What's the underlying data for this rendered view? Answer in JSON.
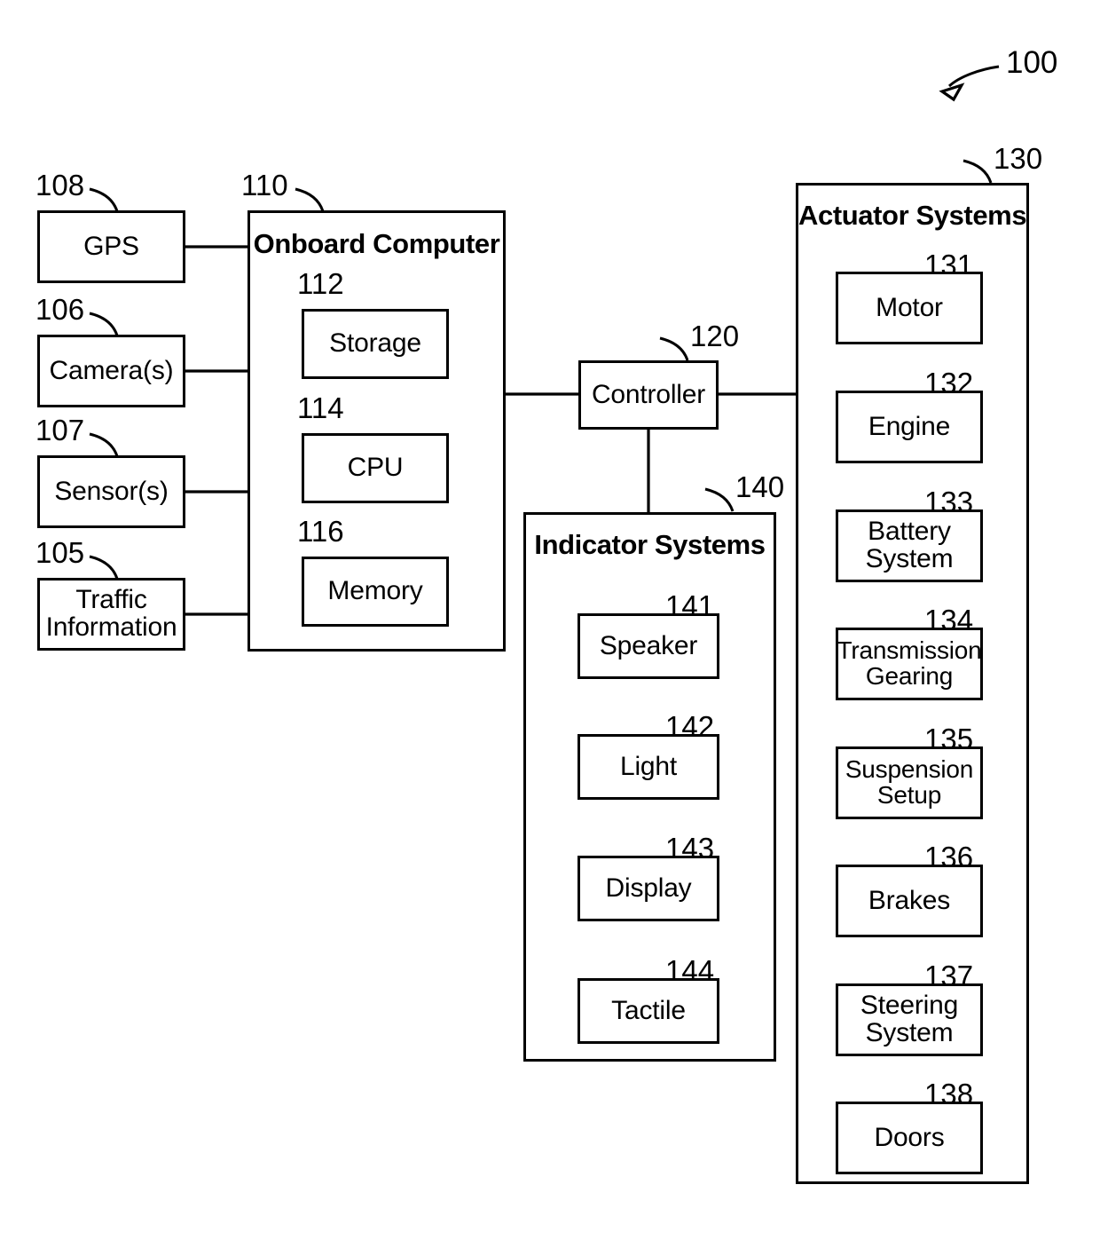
{
  "figure": {
    "label": "100",
    "type": "vehicle-control-system-block-diagram"
  },
  "inputs": [
    {
      "ref": "108",
      "label": "GPS"
    },
    {
      "ref": "106",
      "label": "Camera(s)"
    },
    {
      "ref": "107",
      "label": "Sensor(s)"
    },
    {
      "ref": "105",
      "label": "Traffic\nInformation",
      "line1": "Traffic",
      "line2": "Information"
    }
  ],
  "onboard_computer": {
    "ref": "110",
    "title": "Onboard Computer",
    "components": [
      {
        "ref": "112",
        "label": "Storage"
      },
      {
        "ref": "114",
        "label": "CPU"
      },
      {
        "ref": "116",
        "label": "Memory"
      }
    ]
  },
  "controller": {
    "ref": "120",
    "label": "Controller"
  },
  "indicator_systems": {
    "ref": "140",
    "title": "Indicator Systems",
    "components": [
      {
        "ref": "141",
        "label": "Speaker"
      },
      {
        "ref": "142",
        "label": "Light"
      },
      {
        "ref": "143",
        "label": "Display"
      },
      {
        "ref": "144",
        "label": "Tactile"
      }
    ]
  },
  "actuator_systems": {
    "ref": "130",
    "title": "Actuator Systems",
    "components": [
      {
        "ref": "131",
        "label": "Motor"
      },
      {
        "ref": "132",
        "label": "Engine"
      },
      {
        "ref": "133",
        "label": "Battery System",
        "line1": "Battery",
        "line2": "System"
      },
      {
        "ref": "134",
        "label": "Transmission Gearing",
        "line1": "Transmission",
        "line2": "Gearing"
      },
      {
        "ref": "135",
        "label": "Suspension Setup",
        "line1": "Suspension",
        "line2": "Setup"
      },
      {
        "ref": "136",
        "label": "Brakes"
      },
      {
        "ref": "137",
        "label": "Steering System",
        "line1": "Steering",
        "line2": "System"
      },
      {
        "ref": "138",
        "label": "Doors"
      }
    ]
  },
  "colors": {
    "stroke": "#000000",
    "background": "#ffffff"
  }
}
